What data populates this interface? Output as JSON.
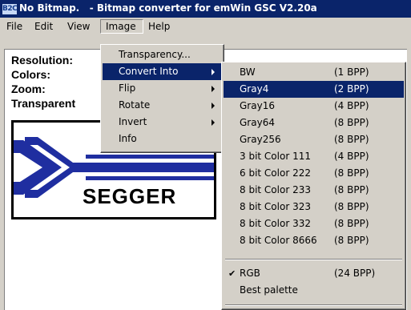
{
  "window": {
    "icon_text": "B2C",
    "title": "No Bitmap.   - Bitmap converter for emWin GSC V2.20a"
  },
  "menubar": {
    "items": [
      "File",
      "Edit",
      "View",
      "Image",
      "Help"
    ]
  },
  "info": {
    "resolution_label": "Resolution:",
    "colors_label": "Colors:",
    "zoom_label": "Zoom:",
    "transparent_label": "Transparent"
  },
  "logo": {
    "text": "SEGGER"
  },
  "image_menu": {
    "items": [
      {
        "label": "Transparency...",
        "submenu": false
      },
      {
        "label": "Convert Into",
        "submenu": true,
        "highlighted": true
      },
      {
        "label": "Flip",
        "submenu": true
      },
      {
        "label": "Rotate",
        "submenu": true
      },
      {
        "label": "Invert",
        "submenu": true
      },
      {
        "label": "Info",
        "submenu": false
      }
    ]
  },
  "convert_menu": {
    "items": [
      {
        "label": "BW",
        "bpp": "(1 BPP)"
      },
      {
        "label": "Gray4",
        "bpp": "(2 BPP)",
        "highlighted": true
      },
      {
        "label": "Gray16",
        "bpp": "(4 BPP)"
      },
      {
        "label": "Gray64",
        "bpp": "(8 BPP)"
      },
      {
        "label": "Gray256",
        "bpp": "(8 BPP)"
      },
      {
        "label": "3 bit Color 111",
        "bpp": "(4 BPP)"
      },
      {
        "label": "6 bit Color 222",
        "bpp": "(8 BPP)"
      },
      {
        "label": "8 bit Color 233",
        "bpp": "(8 BPP)"
      },
      {
        "label": "8 bit Color 323",
        "bpp": "(8 BPP)"
      },
      {
        "label": "8 bit Color 332",
        "bpp": "(8 BPP)"
      },
      {
        "label": "8 bit Color 8666",
        "bpp": "(8 BPP)"
      }
    ],
    "extra_items": [
      {
        "label": "RGB",
        "bpp": "(24 BPP)",
        "checked": true,
        "check_mark": "✔"
      },
      {
        "label": "Best palette",
        "bpp": ""
      }
    ]
  },
  "colors": {
    "titlebar": "#0a246a",
    "highlight": "#0a246a",
    "menu_bg": "#d4d0c8",
    "logo_blue": "#1f2ea0"
  }
}
